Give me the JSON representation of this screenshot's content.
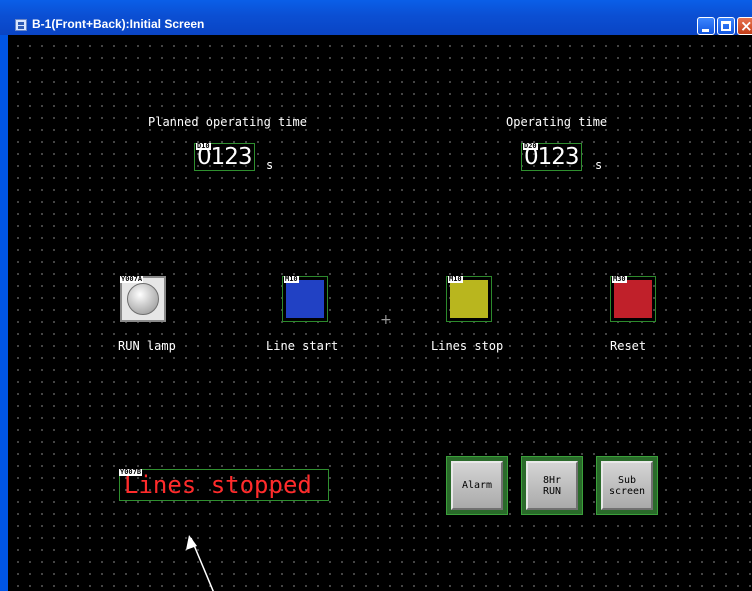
{
  "window": {
    "title": "B-1(Front+Back):Initial Screen"
  },
  "header": {
    "planned": {
      "label": "Planned operating time",
      "device": "D10",
      "value": "0123",
      "unit": "s"
    },
    "operating": {
      "label": "Operating time",
      "device": "D20",
      "value": "0123",
      "unit": "s"
    }
  },
  "switches": {
    "run_lamp": {
      "device": "Y007A",
      "label": "RUN lamp"
    },
    "line_start": {
      "device": "M10",
      "label": "Line start",
      "color": "#2141c4"
    },
    "lines_stop": {
      "device": "M10",
      "label": "Lines stop",
      "color": "#b9b61e"
    },
    "reset": {
      "device": "M30",
      "label": "Reset",
      "color": "#c0202a"
    }
  },
  "message": {
    "device": "Y007B",
    "text": "Lines stopped",
    "color": "#ff2b2b"
  },
  "buttons": {
    "alarm": "Alarm",
    "run8hr": "8Hr\nRUN",
    "subscreen": "Sub\nscreen"
  },
  "icons": {
    "window_icon": "app-window-icon",
    "arrow": "annotation-arrow-icon"
  }
}
